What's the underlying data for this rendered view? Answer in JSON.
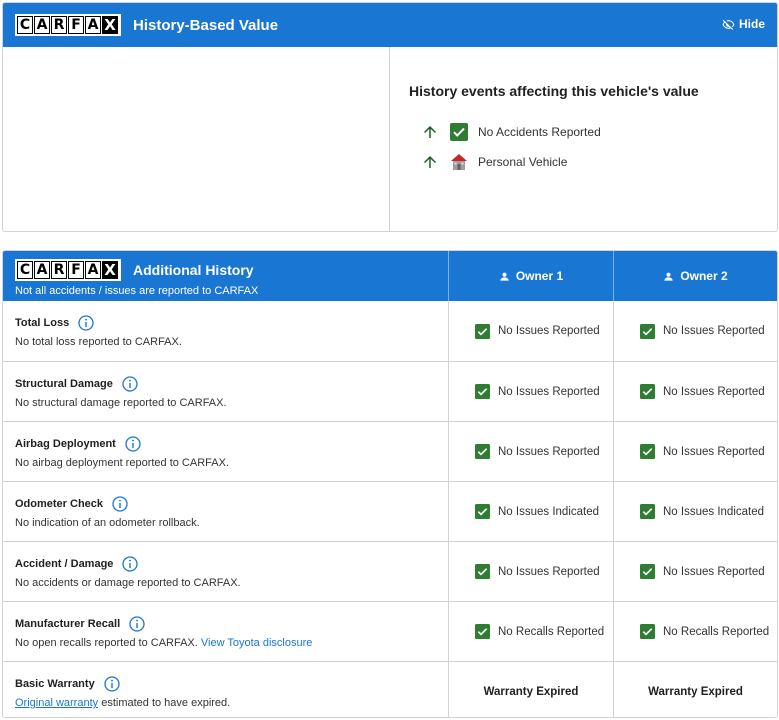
{
  "logo_letters": [
    "C",
    "A",
    "R",
    "F",
    "A",
    "X"
  ],
  "history_based_value": {
    "title": "History-Based Value",
    "hide_label": "Hide",
    "events_title": "History events affecting this vehicle's value",
    "events": [
      {
        "label": "No Accidents Reported",
        "icon": "check-icon",
        "trend": "up"
      },
      {
        "label": "Personal Vehicle",
        "icon": "house-icon",
        "trend": "up"
      }
    ]
  },
  "additional_history": {
    "title": "Additional History",
    "subtitle": "Not all accidents / issues are reported to CARFAX",
    "owners": [
      "Owner 1",
      "Owner 2"
    ],
    "rows": [
      {
        "title": "Total Loss",
        "desc": "No total loss reported to CARFAX.",
        "o1": "No Issues Reported",
        "o2": "No Issues Reported"
      },
      {
        "title": "Structural Damage",
        "desc": "No structural damage reported to CARFAX.",
        "o1": "No Issues Reported",
        "o2": "No Issues Reported"
      },
      {
        "title": "Airbag Deployment",
        "desc": "No airbag deployment reported to CARFAX.",
        "o1": "No Issues Reported",
        "o2": "No Issues Reported"
      },
      {
        "title": "Odometer Check",
        "desc": "No indication of an odometer rollback.",
        "o1": "No Issues Indicated",
        "o2": "No Issues Indicated"
      },
      {
        "title": "Accident / Damage",
        "desc": "No accidents or damage reported to CARFAX.",
        "o1": "No Issues Reported",
        "o2": "No Issues Reported"
      },
      {
        "title": "Manufacturer Recall",
        "desc": "No open recalls reported to CARFAX.",
        "link": "View Toyota disclosure",
        "o1": "No Recalls Reported",
        "o2": "No Recalls Reported"
      },
      {
        "title": "Basic Warranty",
        "desc_link": "Original warranty",
        "desc": "estimated to have expired.",
        "o1": "Warranty Expired",
        "o2": "Warranty Expired"
      }
    ]
  },
  "colors": {
    "brand_blue": "#1976d2",
    "check_green": "#2e7d32",
    "arrow_green": "#1b5e20"
  }
}
